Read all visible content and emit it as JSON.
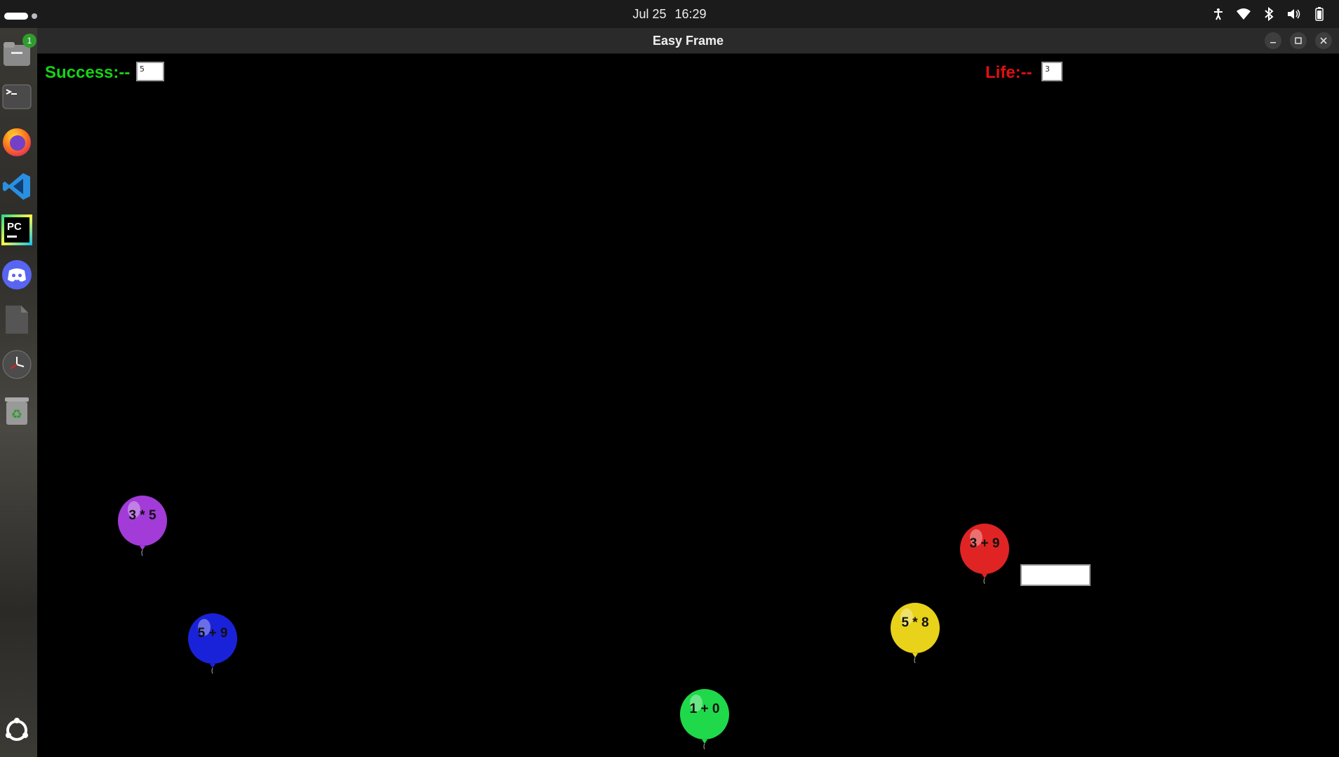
{
  "topbar": {
    "date": "Jul 25",
    "time": "16:29",
    "tray_icons": [
      "accessibility-icon",
      "wifi-icon",
      "bluetooth-icon",
      "volume-icon",
      "battery-icon"
    ]
  },
  "dock": {
    "items": [
      {
        "name": "files-app-icon",
        "badge": "1"
      },
      {
        "name": "terminal-app-icon"
      },
      {
        "name": "firefox-app-icon"
      },
      {
        "name": "vscode-app-icon"
      },
      {
        "name": "pycharm-app-icon",
        "text": "PC"
      },
      {
        "name": "discord-app-icon"
      },
      {
        "name": "document-app-icon"
      },
      {
        "name": "clock-app-icon"
      },
      {
        "name": "trash-app-icon"
      },
      {
        "name": "show-apps-icon"
      }
    ]
  },
  "window": {
    "title": "Easy Frame",
    "controls": [
      "minimize-icon",
      "maximize-icon",
      "close-icon"
    ]
  },
  "game": {
    "success_label": "Success:--",
    "success_value": "5",
    "life_label": "Life:--",
    "life_value": "3",
    "answer_value": "",
    "balloons": [
      {
        "label": "3 * 5",
        "color": "#a23bd8"
      },
      {
        "label": "5 + 9",
        "color": "#1a22d9"
      },
      {
        "label": "1 + 0",
        "color": "#1fd94a"
      },
      {
        "label": "5 * 8",
        "color": "#e8d21a"
      },
      {
        "label": "3 + 9",
        "color": "#e02424"
      }
    ]
  },
  "colors": {
    "success": "#17d217",
    "life": "#e01010",
    "background": "#000000"
  }
}
